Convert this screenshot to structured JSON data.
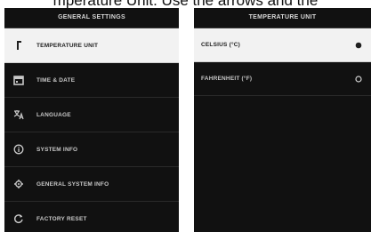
{
  "caption": "mperature Unit. Use the arrows and the",
  "left_screen": {
    "title": "GENERAL SETTINGS",
    "items": [
      {
        "label": "TEMPERATURE UNIT",
        "icon": "thermometer-icon",
        "selected": true
      },
      {
        "label": "TIME & DATE",
        "icon": "calendar-icon",
        "selected": false
      },
      {
        "label": "LANGUAGE",
        "icon": "language-icon",
        "selected": false
      },
      {
        "label": "SYSTEM INFO",
        "icon": "info-icon",
        "selected": false
      },
      {
        "label": "GENERAL SYSTEM INFO",
        "icon": "gear-icon",
        "selected": false
      },
      {
        "label": "FACTORY RESET",
        "icon": "reset-icon",
        "selected": false
      }
    ]
  },
  "right_screen": {
    "title": "TEMPERATURE UNIT",
    "options": [
      {
        "label": "CELSIUS (°C)",
        "selected": true
      },
      {
        "label": "FAHRENHEIT (°F)",
        "selected": false
      }
    ]
  },
  "colors": {
    "screen_bg": "#111111",
    "selected_bg": "#f2f2f2",
    "text": "#c8c8c8"
  }
}
